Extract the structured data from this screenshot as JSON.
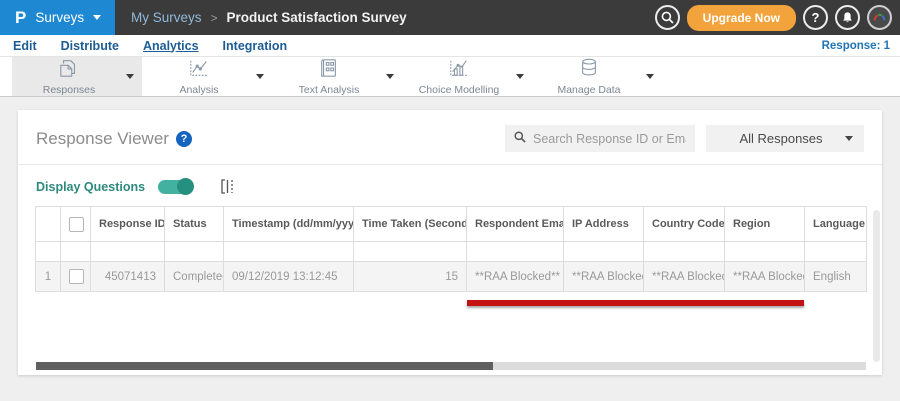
{
  "colors": {
    "brand_blue": "#1e88d2",
    "topbar_gray": "#3b3b3b",
    "upgrade_orange": "#f2a33c",
    "teal_toggle": "#43b1a0",
    "annotation_red": "#c41212",
    "link_blue": "#2175b4"
  },
  "topbar": {
    "logo_glyph": "P",
    "product": "Surveys",
    "breadcrumb": {
      "section": "My Surveys",
      "separator": ">",
      "page": "Product Satisfaction Survey"
    },
    "upgrade_label": "Upgrade Now",
    "help_glyph": "?"
  },
  "nav": {
    "items": [
      {
        "label": "Edit"
      },
      {
        "label": "Distribute"
      },
      {
        "label": "Analytics"
      },
      {
        "label": "Integration"
      }
    ],
    "active": "Analytics",
    "response_counter": "Response: 1"
  },
  "toolbar": {
    "items": [
      {
        "label": "Responses",
        "icon": "responses-icon",
        "active": true
      },
      {
        "label": "Analysis",
        "icon": "analysis-icon",
        "active": false
      },
      {
        "label": "Text Analysis",
        "icon": "text-analysis-icon",
        "active": false
      },
      {
        "label": "Choice Modelling",
        "icon": "choice-modelling-icon",
        "active": false
      },
      {
        "label": "Manage Data",
        "icon": "manage-data-icon",
        "active": false
      }
    ]
  },
  "viewer": {
    "title": "Response Viewer",
    "help_glyph": "?",
    "search_placeholder": "Search Response ID or Email",
    "filter_dropdown": "All Responses",
    "display_questions_label": "Display Questions",
    "display_questions_on": true
  },
  "table": {
    "columns": {
      "response_id": "Response ID",
      "status": "Status",
      "timestamp": "Timestamp (dd/mm/yyyy)",
      "time_taken": "Time Taken (Seconds)",
      "email": "Respondent Email",
      "ip": "IP Address",
      "country": "Country Code",
      "region": "Region",
      "language": "Language"
    },
    "sort": {
      "response_id": "desc"
    },
    "row": {
      "num": "1",
      "response_id": "45071413",
      "status": "Completed",
      "timestamp": "09/12/2019 13:12:45",
      "time_taken": "15",
      "email": "**RAA Blocked**",
      "ip": "**RAA Blocked**",
      "country": "**RAA Blocked**",
      "region": "**RAA Blocked**",
      "language": "English"
    }
  }
}
